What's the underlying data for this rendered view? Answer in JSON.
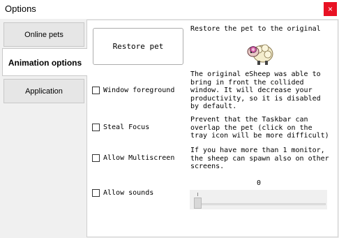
{
  "window": {
    "title": "Options",
    "close_glyph": "×"
  },
  "tabs": [
    {
      "label": "Online pets",
      "active": false
    },
    {
      "label": "Animation options",
      "active": true
    },
    {
      "label": "Application",
      "active": false
    }
  ],
  "restore": {
    "button_label": "Restore pet",
    "description": "Restore the pet to the original"
  },
  "options": [
    {
      "label": "Window foreground",
      "checked": false,
      "description": "The original eSheep was able to\nbring in front the collided\nwindow. It will decrease your\nproductivity, so it is disabled\nby default."
    },
    {
      "label": "Steal Focus",
      "checked": false,
      "description": "Prevent that the Taskbar can\noverlap the pet (click on the\ntray icon will be more difficult)"
    },
    {
      "label": "Allow Multiscreen",
      "checked": false,
      "description": "If you have more than 1 monitor,\nthe sheep can spawn also on other\nscreens."
    },
    {
      "label": "Allow sounds",
      "checked": false,
      "description": ""
    }
  ],
  "volume": {
    "value": "0",
    "level": 0
  },
  "icons": {
    "pet": "sheep-icon",
    "close": "close-icon"
  },
  "colors": {
    "close_bg": "#e81123",
    "panel_bg": "#f0f0f0"
  }
}
